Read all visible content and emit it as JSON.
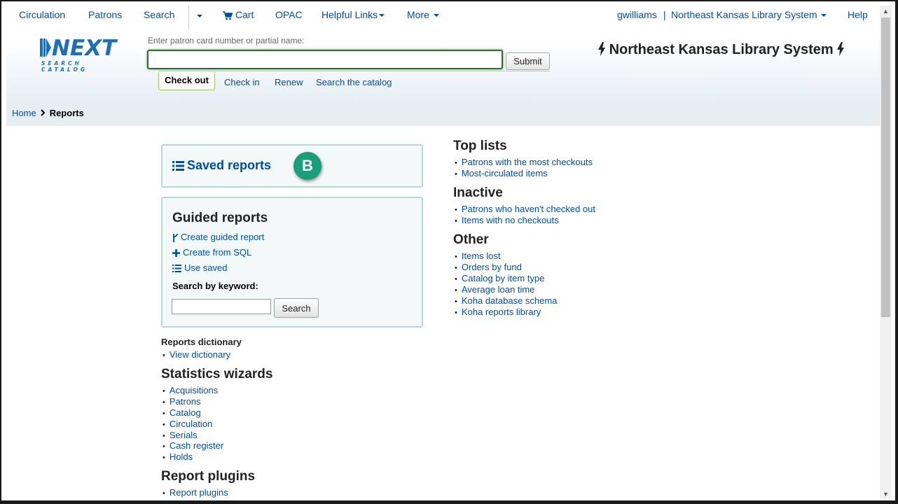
{
  "topnav": {
    "circulation": "Circulation",
    "patrons": "Patrons",
    "search": "Search",
    "cart": "Cart",
    "opac": "OPAC",
    "helpful_links": "Helpful Links",
    "more": "More",
    "user": "gwilliams",
    "separator": "|",
    "library": "Northeast Kansas Library System",
    "help": "Help"
  },
  "logo": {
    "main": "NEXT",
    "sub": "SEARCH CATALOG"
  },
  "checkout_form": {
    "label": "Enter patron card number or partial name:",
    "input_value": "",
    "submit": "Submit",
    "tabs": [
      "Check out",
      "Check in",
      "Renew",
      "Search the catalog"
    ],
    "active_tab": "Check out"
  },
  "library_banner": "Northeast Kansas Library System",
  "breadcrumb": {
    "home": "Home",
    "current": "Reports"
  },
  "saved_reports": {
    "title": "Saved reports",
    "badge": "B"
  },
  "guided_reports": {
    "title": "Guided reports",
    "links": [
      "Create guided report",
      "Create from SQL",
      "Use saved"
    ],
    "keyword_label": "Search by keyword:",
    "keyword_value": "",
    "search_button": "Search"
  },
  "reports_dictionary": {
    "title": "Reports dictionary",
    "items": [
      "View dictionary"
    ]
  },
  "statistics_wizards": {
    "title": "Statistics wizards",
    "items": [
      "Acquisitions",
      "Patrons",
      "Catalog",
      "Circulation",
      "Serials",
      "Cash register",
      "Holds"
    ]
  },
  "report_plugins": {
    "title": "Report plugins",
    "items": [
      "Report plugins"
    ]
  },
  "top_lists": {
    "title": "Top lists",
    "items": [
      "Patrons with the most checkouts",
      "Most-circulated items"
    ]
  },
  "inactive": {
    "title": "Inactive",
    "items": [
      "Patrons who haven't checked out",
      "Items with no checkouts"
    ]
  },
  "other": {
    "title": "Other",
    "items": [
      "Items lost",
      "Orders by fund",
      "Catalog by item type",
      "Average loan time",
      "Koha database schema",
      "Koha reports library"
    ]
  },
  "colors": {
    "link": "#004d99",
    "badge": "#1a9e78",
    "panel_border": "#b8d8d8"
  }
}
